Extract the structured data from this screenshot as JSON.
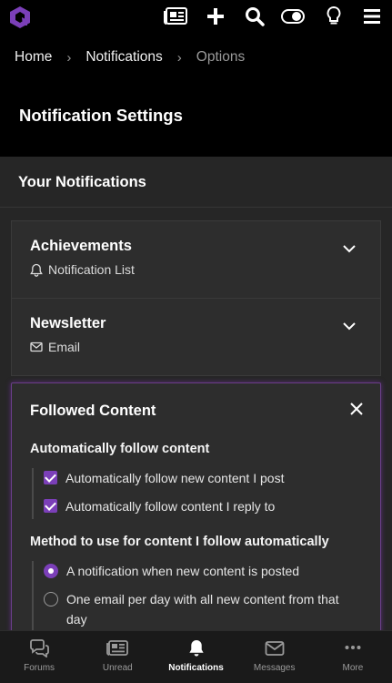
{
  "colors": {
    "accent": "#7b3fb8",
    "background": "#000000",
    "panel": "#262626",
    "card": "#2d2d2d"
  },
  "topbar": {
    "icons": [
      "logo-icon",
      "newspaper-icon",
      "plus-icon",
      "search-icon",
      "toggle-icon",
      "lightbulb-icon",
      "menu-icon"
    ]
  },
  "breadcrumb": {
    "items": [
      "Home",
      "Notifications",
      "Options"
    ],
    "separator": "›"
  },
  "page": {
    "title": "Notification Settings"
  },
  "section": {
    "title": "Your Notifications"
  },
  "accordions": [
    {
      "title": "Achievements",
      "subtitle": "Notification List",
      "icon": "bell-icon",
      "expanded": false
    },
    {
      "title": "Newsletter",
      "subtitle": "Email",
      "icon": "envelope-icon",
      "expanded": false
    }
  ],
  "followed": {
    "title": "Followed Content",
    "expanded": true,
    "auto_follow": {
      "title": "Automatically follow content",
      "options": [
        {
          "label": "Automatically follow new content I post",
          "checked": true
        },
        {
          "label": "Automatically follow content I reply to",
          "checked": true
        }
      ]
    },
    "method": {
      "title": "Method to use for content I follow automatically",
      "options": [
        {
          "label": "A notification when new content is posted",
          "selected": true
        },
        {
          "label_line1": "One email per day with all new content from that",
          "label_line2": "day",
          "selected": false
        }
      ]
    }
  },
  "bottomnav": {
    "items": [
      {
        "label": "Forums",
        "icon": "chat-bubbles-icon",
        "active": false
      },
      {
        "label": "Unread",
        "icon": "newspaper-icon",
        "active": false
      },
      {
        "label": "Notifications",
        "icon": "bell-icon",
        "active": true
      },
      {
        "label": "Messages",
        "icon": "envelope-icon",
        "active": false
      },
      {
        "label": "More",
        "icon": "ellipsis-icon",
        "active": false
      }
    ]
  }
}
